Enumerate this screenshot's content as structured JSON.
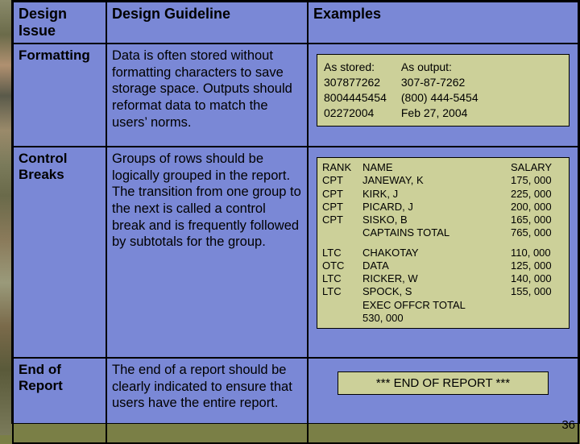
{
  "page_number": "36",
  "headers": {
    "issue": "Design Issue",
    "guideline": "Design Guideline",
    "examples": "Examples"
  },
  "rows": {
    "formatting": {
      "issue": "Formatting",
      "guideline": "Data is often stored without formatting characters to save storage space. Outputs should reformat data to match the users’ norms.",
      "example": {
        "stored_label": "As stored:",
        "output_label": "As output:",
        "stored": [
          "307877262",
          "8004445454",
          "02272004"
        ],
        "output": [
          "307-87-7262",
          "(800) 444-5454",
          "Feb 27, 2004"
        ]
      }
    },
    "control": {
      "issue": "Control Breaks",
      "guideline": "Groups of rows should be logically grouped in the report. The transition from one group to the next is called a control break and is frequently followed by subtotals for the group.",
      "example": {
        "headers": {
          "rank": "RANK",
          "name": "NAME",
          "salary": "SALARY"
        },
        "group1": [
          {
            "rank": "CPT",
            "name": "JANEWAY, K",
            "salary": "175, 000"
          },
          {
            "rank": "CPT",
            "name": "KIRK, J",
            "salary": "225, 000"
          },
          {
            "rank": "CPT",
            "name": "PICARD, J",
            "salary": "200, 000"
          },
          {
            "rank": "CPT",
            "name": "SISKO, B",
            "salary": "165, 000"
          }
        ],
        "group1_total": {
          "label": "CAPTAINS TOTAL",
          "value": "765, 000"
        },
        "group2": [
          {
            "rank": "LTC",
            "name": "CHAKOTAY",
            "salary": "110, 000"
          },
          {
            "rank": "OTC",
            "name": "DATA",
            "salary": "125, 000"
          },
          {
            "rank": "LTC",
            "name": "RICKER, W",
            "salary": "140, 000"
          },
          {
            "rank": "LTC",
            "name": "SPOCK, S",
            "salary": "155, 000"
          }
        ],
        "group2_total": {
          "label": "EXEC OFFCR TOTAL",
          "value": "530, 000"
        }
      }
    },
    "endreport": {
      "issue": "End of Report",
      "guideline": "The end of a report should be clearly indicated to ensure that users have the entire report.",
      "example": "*** END OF REPORT ***"
    }
  }
}
